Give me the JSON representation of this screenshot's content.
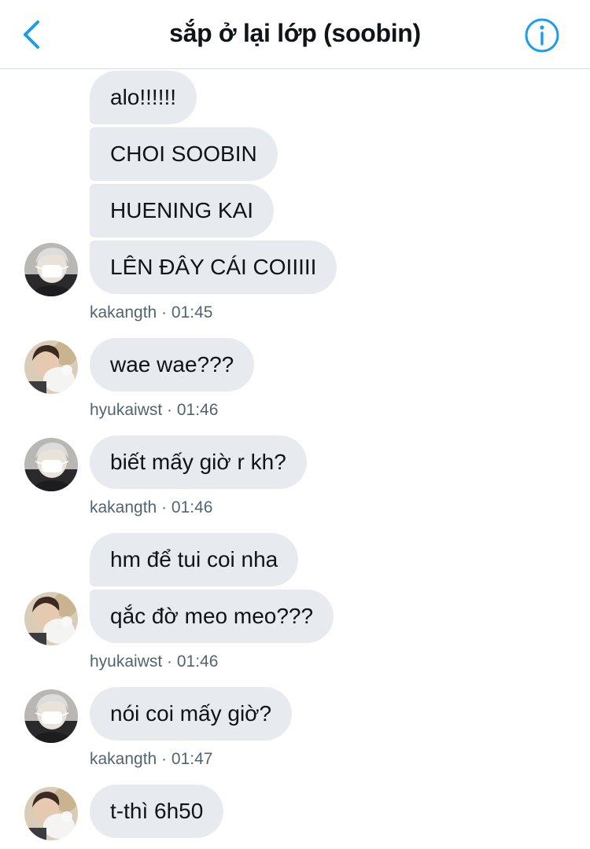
{
  "header": {
    "title": "sắp ở lại lớp (soobin)",
    "back_icon": "chevron-left-icon",
    "info_icon": "info-circle-icon",
    "accent_color": "#1d9bf0"
  },
  "messages": [
    {
      "text": "alo!!!!!!"
    },
    {
      "text": "CHOI SOOBIN"
    },
    {
      "text": "HUENING KAI"
    },
    {
      "text": "LÊN ĐÂY CÁI COIIIII"
    },
    {
      "text": "wae wae???"
    },
    {
      "text": "biết mấy giờ r kh?"
    },
    {
      "text": "hm để tui coi nha"
    },
    {
      "text": "qắc đờ meo meo???"
    },
    {
      "text": "nói coi mấy giờ?"
    },
    {
      "text": "t-thì 6h50"
    }
  ],
  "meta": [
    {
      "text": "kakangth · 01:45"
    },
    {
      "text": "hyukaiwst · 01:46"
    },
    {
      "text": "kakangth · 01:46"
    },
    {
      "text": "hyukaiwst · 01:46"
    },
    {
      "text": "kakangth · 01:47"
    }
  ],
  "colors": {
    "bubble_bg": "#e7ebef",
    "text": "#0f1419",
    "meta_text": "#536471"
  }
}
